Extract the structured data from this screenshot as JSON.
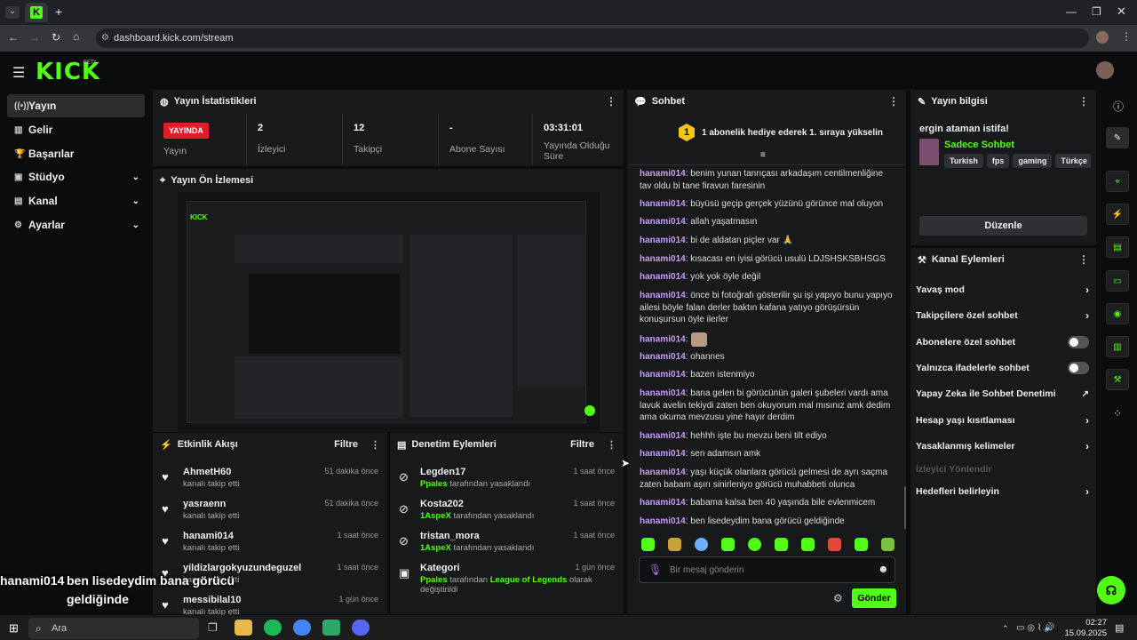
{
  "browser": {
    "url": "dashboard.kick.com/stream",
    "new_tab": "+",
    "clock_time": "02:27",
    "clock_date": "15.09.2025",
    "search_placeholder": "Ara"
  },
  "brand": {
    "logo": "KICK",
    "beta": "BETA",
    "accent": "#53fc18"
  },
  "nav": [
    {
      "label": "Yayın"
    },
    {
      "label": "Gelir"
    },
    {
      "label": "Başarılar"
    },
    {
      "label": "Stüdyo"
    },
    {
      "label": "Kanal"
    },
    {
      "label": "Ayarlar"
    }
  ],
  "stats": {
    "title": "Yayın İstatistikleri",
    "live_badge": "YAYINDA",
    "live_label": "Yayın",
    "viewers": "2",
    "viewers_label": "İzleyici",
    "followers": "12",
    "followers_label": "Takipçi",
    "subs": "-",
    "subs_label": "Abone Sayısı",
    "duration": "03:31:01",
    "duration_label": "Yayında Olduğu Süre"
  },
  "preview": {
    "title": "Yayın Ön İzlemesi"
  },
  "activity": {
    "title": "Etkinlik Akışı",
    "filter": "Filtre",
    "items": [
      {
        "name": "AhmetH60",
        "sub": "kanalı takip etti",
        "time": "51 dakika önce"
      },
      {
        "name": "yasraenn",
        "sub": "kanalı takip etti",
        "time": "51 dakika önce"
      },
      {
        "name": "hanami014",
        "sub": "kanalı takip etti",
        "time": "1 saat önce"
      },
      {
        "name": "yildizlargokyuzundeguzel",
        "sub": "kanalı takip etti",
        "time": "1 saat önce"
      },
      {
        "name": "messibilal10",
        "sub": "kanalı takip etti",
        "time": "1 gün önce"
      }
    ]
  },
  "moderation": {
    "title": "Denetim Eylemleri",
    "filter": "Filtre",
    "items": [
      {
        "name": "Legden17",
        "by": "Ppales",
        "sub": "tarafından yasaklandı",
        "time": "1 saat önce"
      },
      {
        "name": "Kosta202",
        "by": "1AspeX",
        "sub": "tarafından yasaklandı",
        "time": "1 saat önce"
      },
      {
        "name": "tristan_mora",
        "by": "1AspeX",
        "sub": "tarafından yasaklandı",
        "time": "1 saat önce"
      }
    ],
    "category": {
      "name": "Kategori",
      "by": "Ppales",
      "mid": "tarafından",
      "game": "League of Legends",
      "end": "olarak değiştirildi",
      "time": "1 gün önce"
    }
  },
  "chat": {
    "title": "Sohbet",
    "pinned_rank": "1",
    "pinned": "1 abonelik hediye ederek 1. sıraya yükselin",
    "messages": [
      {
        "u": "hanami014",
        "t": ": benim yunan tanrıçası arkadaşım centilmenliğine tav oldu bi tane firavun faresinin"
      },
      {
        "u": "hanami014",
        "t": ": büyüsü geçip gerçek yüzünü görünce mal oluyon"
      },
      {
        "u": "hanami014",
        "t": ": allah yaşatmasın"
      },
      {
        "u": "hanami014",
        "t": ": bi de aldatan piçler var 🙏"
      },
      {
        "u": "hanami014",
        "t": ": kısacası en iyisi görücü usulü LDJSHSKSBHSGS"
      },
      {
        "u": "hanami014",
        "t": ": yok yok öyle değil"
      },
      {
        "u": "hanami014",
        "t": ": önce bi fotoğrafı gösterilir şu işi yapıyo bunu yapıyo ailesi böyle falan derler baktın kafana yatıyo görüşürsün konuşursun öyle ilerler"
      },
      {
        "u": "hanami014",
        "t": ":"
      },
      {
        "u": "hanami014",
        "t": ": ohannes"
      },
      {
        "u": "hanami014",
        "t": ": bazen istenmiyo"
      },
      {
        "u": "hanami014",
        "t": ": bana gelen bi görücünün galeri şubeleri vardı ama lavuk avelin tekiydi zaten ben okuyorum mal mısınız amk dedim ama okuma mevzusu yine hayır derdim"
      },
      {
        "u": "hanami014",
        "t": ": hehhh işte bu mevzu beni tilt ediyo"
      },
      {
        "u": "hanami014",
        "t": ": sen adamsın amk"
      },
      {
        "u": "hanami014",
        "t": ": yaşı küçük olanlara görücü gelmesi de ayrı saçma zaten babam aşırı sinirleniyo görücü muhabbeti olunca"
      },
      {
        "u": "hanami014",
        "t": ": babama kalsa ben 40 yaşında bile evlenmicem"
      },
      {
        "u": "hanami014",
        "t": ": ben lisedeydim bana görücü geldiğinde"
      }
    ],
    "placeholder": "Bir mesaj gönderin",
    "send": "Gönder"
  },
  "stream_info": {
    "title": "Yayın bilgisi",
    "stream_title": "ergin ataman istifa!",
    "subs_only": "Sadece Sohbet",
    "tags": [
      "Turkish",
      "fps",
      "gaming",
      "Türkçe"
    ],
    "edit": "Düzenle"
  },
  "channel_actions": {
    "title": "Kanal Eylemleri",
    "items": [
      "Yavaş mod",
      "Takipçilere özel sohbet",
      "Abonelere özel sohbet",
      "Yalnızca ifadelerle sohbet",
      "Yapay Zeka ile Sohbet Denetimi",
      "Hesap yaşı kısıtlaması",
      "Yasaklanmış kelimeler",
      "İzleyici Yönlendir",
      "Hedefleri belirleyin"
    ]
  },
  "overlay": {
    "user": "hanami014",
    "line1": "ben lisedeydim bana görücü",
    "line2": "geldiğinde"
  }
}
